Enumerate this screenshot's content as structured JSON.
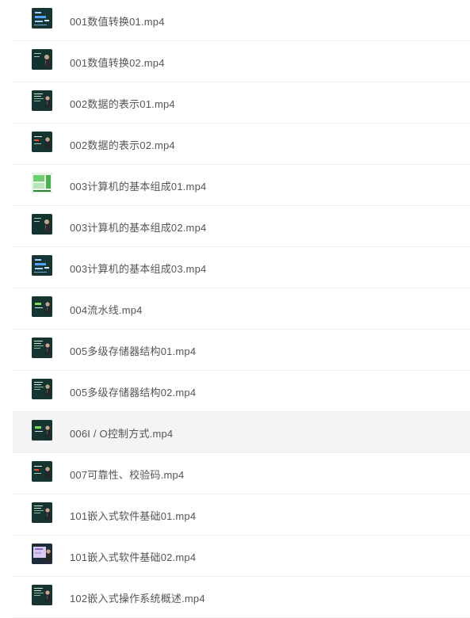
{
  "files": [
    {
      "name": "001数值转换01.mp4",
      "thumb": "thumb-diagram-blue"
    },
    {
      "name": "001数值转换02.mp4",
      "thumb": "thumb-presenter"
    },
    {
      "name": "002数据的表示01.mp4",
      "thumb": "thumb-presenter-text"
    },
    {
      "name": "002数据的表示02.mp4",
      "thumb": "thumb-presenter-red"
    },
    {
      "name": "003计算机的基本组成01.mp4",
      "thumb": "thumb-green-slide"
    },
    {
      "name": "003计算机的基本组成02.mp4",
      "thumb": "thumb-presenter"
    },
    {
      "name": "003计算机的基本组成03.mp4",
      "thumb": "thumb-diagram-blue"
    },
    {
      "name": "004流水线.mp4",
      "thumb": "thumb-presenter-green"
    },
    {
      "name": "005多级存储器结构01.mp4",
      "thumb": "thumb-presenter-text"
    },
    {
      "name": "005多级存储器结构02.mp4",
      "thumb": "thumb-presenter-text"
    },
    {
      "name": "006I / O控制方式.mp4",
      "thumb": "thumb-presenter-green"
    },
    {
      "name": "007可靠性、校验码.mp4",
      "thumb": "thumb-presenter-red"
    },
    {
      "name": "101嵌入式软件基础01.mp4",
      "thumb": "thumb-presenter-text"
    },
    {
      "name": "101嵌入式软件基础02.mp4",
      "thumb": "thumb-purple-slide"
    },
    {
      "name": "102嵌入式操作系统概述.mp4",
      "thumb": "thumb-presenter-text"
    }
  ],
  "hovered_index": 10,
  "colors": {
    "text": "#555555",
    "row_divider": "#eeeeee",
    "hover_bg": "#f4f4f4",
    "thumb_bg": "#173532"
  }
}
